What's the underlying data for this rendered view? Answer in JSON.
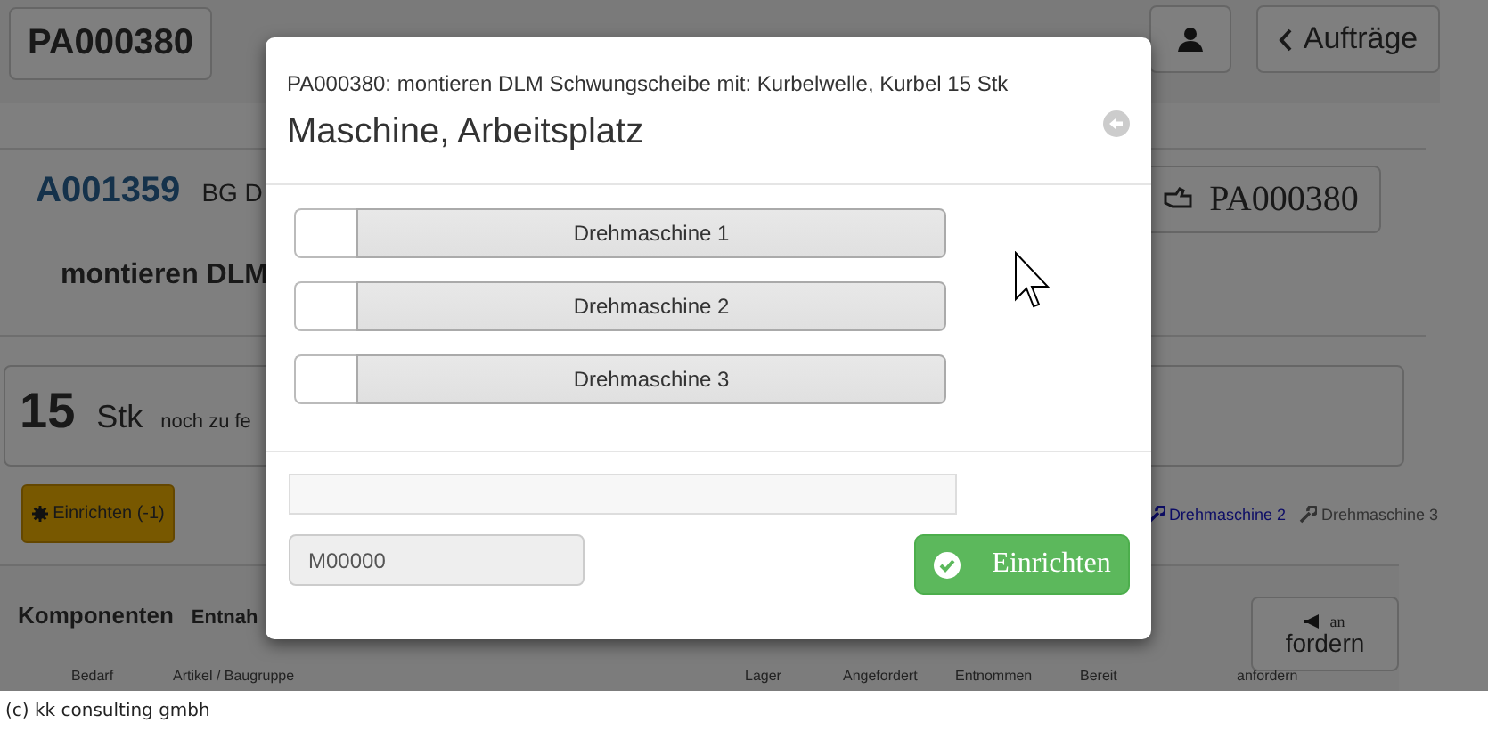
{
  "header": {
    "order_button": "PA000380",
    "back_button": "Aufträge"
  },
  "order": {
    "id": "A001359",
    "label": "BG D",
    "description": "montieren DLM",
    "order_button": "PA000380"
  },
  "quantity": {
    "count": "15",
    "unit": "Stk",
    "note": "noch zu fe"
  },
  "setup_button": "Einrichten (-1)",
  "machine_links": [
    {
      "label": "Drehmaschine 2",
      "active": true
    },
    {
      "label": "Drehmaschine 3",
      "active": false
    }
  ],
  "components": {
    "title": "Komponenten",
    "tab": "Entnah",
    "request_button": {
      "line_1": "an",
      "line_2": "fordern"
    },
    "columns": [
      "Bedarf",
      "Artikel / Baugruppe",
      "Lager",
      "Angefordert",
      "Entnommen",
      "Bereit",
      "anfordern"
    ]
  },
  "dialog": {
    "subtitle": "PA000380: montieren DLM Schwungscheibe mit: Kurbelwelle, Kurbel 15 Stk",
    "title": "Maschine, Arbeitsplatz",
    "machines": [
      {
        "label": "Drehmaschine 1",
        "selected": false
      },
      {
        "label": "Drehmaschine 2",
        "selected": false
      },
      {
        "label": "Drehmaschine 3",
        "selected": false
      }
    ],
    "machine_field": {
      "value": "M00000"
    },
    "confirm_button": "Einrichten"
  },
  "footer": "(c) kk consulting gmbh"
}
